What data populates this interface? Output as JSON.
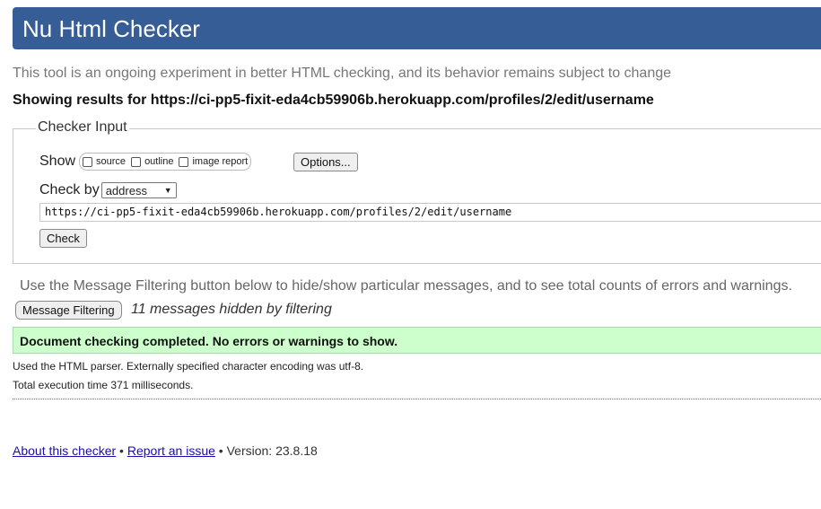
{
  "header": {
    "title": "Nu Html Checker"
  },
  "intro": "This tool is an ongoing experiment in better HTML checking, and its behavior remains subject to change",
  "showing": "Showing results for https://ci-pp5-fixit-eda4cb59906b.herokuapp.com/profiles/2/edit/username",
  "checker_input": {
    "legend": "Checker Input",
    "show_label": "Show",
    "show_options": [
      {
        "label": "source",
        "checked": false
      },
      {
        "label": "outline",
        "checked": false
      },
      {
        "label": "image report",
        "checked": false
      }
    ],
    "options_button": "Options...",
    "check_by_label": "Check by",
    "check_by_value": "address",
    "url_value": "https://ci-pp5-fixit-eda4cb59906b.herokuapp.com/profiles/2/edit/username",
    "check_button": "Check"
  },
  "filtering": {
    "text": "Use the Message Filtering button below to hide/show particular messages, and to see total counts of errors and warnings.",
    "button": "Message Filtering",
    "hidden": "11 messages hidden by filtering"
  },
  "result": {
    "success": "Document checking completed. No errors or warnings to show.",
    "parser": "Used the HTML parser. Externally specified character encoding was utf-8.",
    "exec_time": "Total execution time 371 milliseconds."
  },
  "footer": {
    "about_link": "About this checker",
    "sep1": " • ",
    "report_link": "Report an issue",
    "version": " • Version: 23.8.18"
  },
  "colors": {
    "header_bg": "#365d95",
    "success_bg": "#ccffcc"
  }
}
